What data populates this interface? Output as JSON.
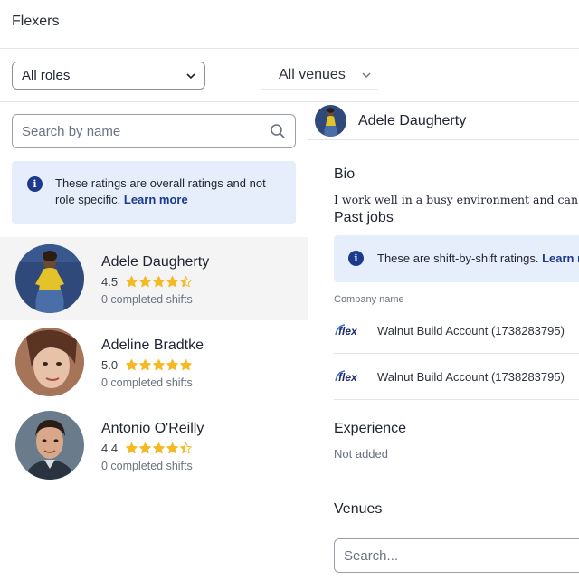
{
  "header": {
    "title": "Flexers"
  },
  "filters": {
    "role_label": "All roles",
    "venue_label": "All venues"
  },
  "search": {
    "placeholder": "Search by name"
  },
  "info_notice": {
    "text": "These ratings are overall ratings and not role specific.",
    "link": "Learn more"
  },
  "flexers": [
    {
      "name": "Adele Daugherty",
      "rating": "4.5",
      "stars": 4.5,
      "shifts": "0 completed shifts",
      "selected": true
    },
    {
      "name": "Adeline Bradtke",
      "rating": "5.0",
      "stars": 5.0,
      "shifts": "0 completed shifts",
      "selected": false
    },
    {
      "name": "Antonio O'Reilly",
      "rating": "4.4",
      "stars": 4.4,
      "shifts": "0 completed shifts",
      "selected": false
    }
  ],
  "detail": {
    "name": "Adele Daugherty",
    "bio_title": "Bio",
    "bio_text": "I work well in a busy environment and can mana",
    "past_jobs_title": "Past jobs",
    "past_jobs_notice": "These are shift-by-shift ratings.",
    "past_jobs_link": "Learn m",
    "company_label": "Company name",
    "jobs": [
      {
        "company": "Walnut Build Account (1738283795)",
        "logo_text": "flex"
      },
      {
        "company": "Walnut Build Account (1738283795)",
        "logo_text": "flex"
      }
    ],
    "experience_title": "Experience",
    "experience_text": "Not added",
    "venues_title": "Venues",
    "venues_search_placeholder": "Search..."
  },
  "colors": {
    "accent": "#1b3a8c",
    "info_bg": "#e6eefb",
    "star": "#f5b923",
    "selected_row": "#f4f4f5"
  }
}
